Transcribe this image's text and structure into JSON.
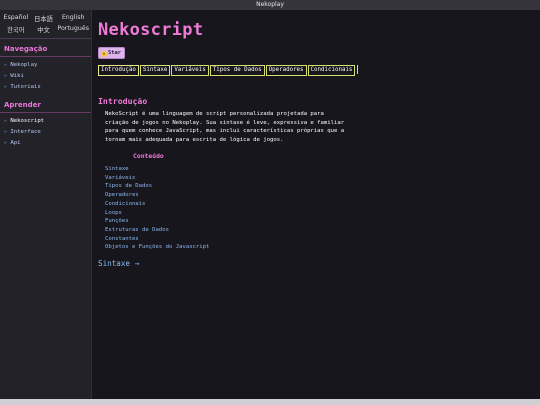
{
  "window": {
    "title": "Nekoplay"
  },
  "languages": [
    "Español",
    "日本語",
    "English",
    "한국어",
    "中文",
    "Português"
  ],
  "sidebar": {
    "sections": [
      {
        "heading": "Navegação",
        "items": [
          {
            "label": "Nekoplay"
          },
          {
            "label": "Wiki"
          },
          {
            "label": "Tutoriais"
          }
        ]
      },
      {
        "heading": "Aprender",
        "items": [
          {
            "label": "Nekoscript"
          },
          {
            "label": "Interface"
          },
          {
            "label": "Api"
          }
        ]
      }
    ],
    "bullet": "▹"
  },
  "page": {
    "title": "Nekoscript",
    "star_label": "Star",
    "star_icon": "star-icon",
    "tabs": [
      "Introdução",
      "Sintaxe",
      "Variáveis",
      "Tipos de Dados",
      "Operadores",
      "Condicionais"
    ],
    "active_tab": "Introdução",
    "section_title": "Introdução",
    "intro_lines": [
      "NekoScript é uma linguagem de script personalizada projetada para",
      "criação de jogos no Nekoplay. Sua sintaxe é leve, expressiva e familiar",
      "para quem conhece JavaScript, mas inclui características próprias que a",
      "tornam mais adequada para escrita de lógica de jogos."
    ],
    "toc_title": "Conteúdo",
    "toc": [
      "Sintaxe",
      "Variáveis",
      "Tipos de Dados",
      "Operadores",
      "Condicionais",
      "Loops",
      "Funções",
      "Estruturas de Dados",
      "Constantes",
      "Objetos e Funções do Javascript"
    ],
    "next_link": "Sintaxe →"
  },
  "colors": {
    "accent_pink": "#f07ad8",
    "link_blue": "#8fb8f0",
    "tab_border": "#d8e070",
    "background": "#16161c",
    "sidebar_bg": "#222228"
  }
}
